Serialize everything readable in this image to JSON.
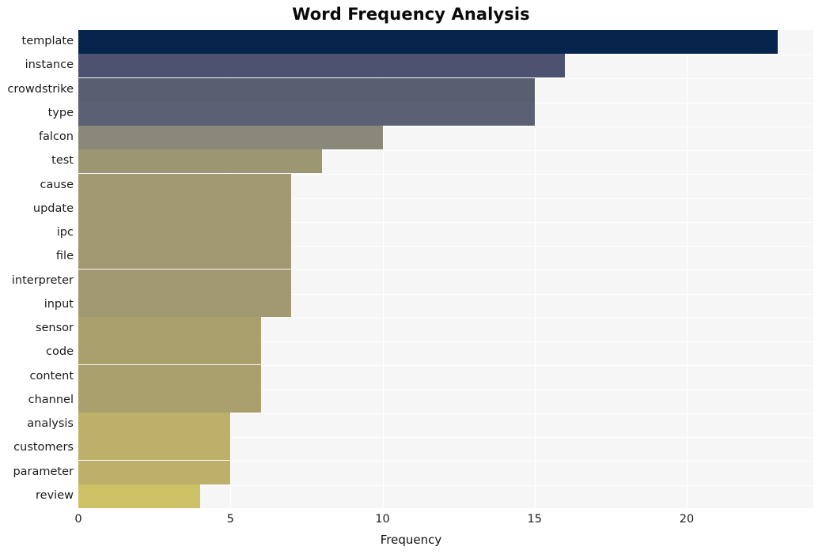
{
  "chart_data": {
    "type": "bar",
    "orientation": "horizontal",
    "title": "Word Frequency Analysis",
    "xlabel": "Frequency",
    "ylabel": "",
    "categories": [
      "template",
      "instance",
      "crowdstrike",
      "type",
      "falcon",
      "test",
      "cause",
      "update",
      "ipc",
      "file",
      "interpreter",
      "input",
      "sensor",
      "code",
      "content",
      "channel",
      "analysis",
      "customers",
      "parameter",
      "review"
    ],
    "values": [
      23,
      16,
      15,
      15,
      10,
      8,
      7,
      7,
      7,
      7,
      7,
      7,
      6,
      6,
      6,
      6,
      5,
      5,
      5,
      4
    ],
    "bar_colors": [
      "#06244c",
      "#4d5270",
      "#595e71",
      "#5b6074",
      "#8a8878",
      "#9c9672",
      "#a09972",
      "#a09972",
      "#a09972",
      "#a09972",
      "#a09972",
      "#a09972",
      "#aaa06e",
      "#aaa06e",
      "#aaa06e",
      "#aaa06e",
      "#bdb06a",
      "#bdb06a",
      "#bdb06a",
      "#cdc166"
    ],
    "xlim": [
      0,
      24.16
    ],
    "xticks": [
      0,
      5,
      10,
      15,
      20
    ],
    "xtick_labels": [
      "0",
      "5",
      "10",
      "15",
      "20"
    ],
    "grid": {
      "vertical": true,
      "horizontal": true,
      "color": "#ffffff"
    },
    "plot_background": "#f6f6f7",
    "figure_background": "#ffffff",
    "legend": null
  }
}
